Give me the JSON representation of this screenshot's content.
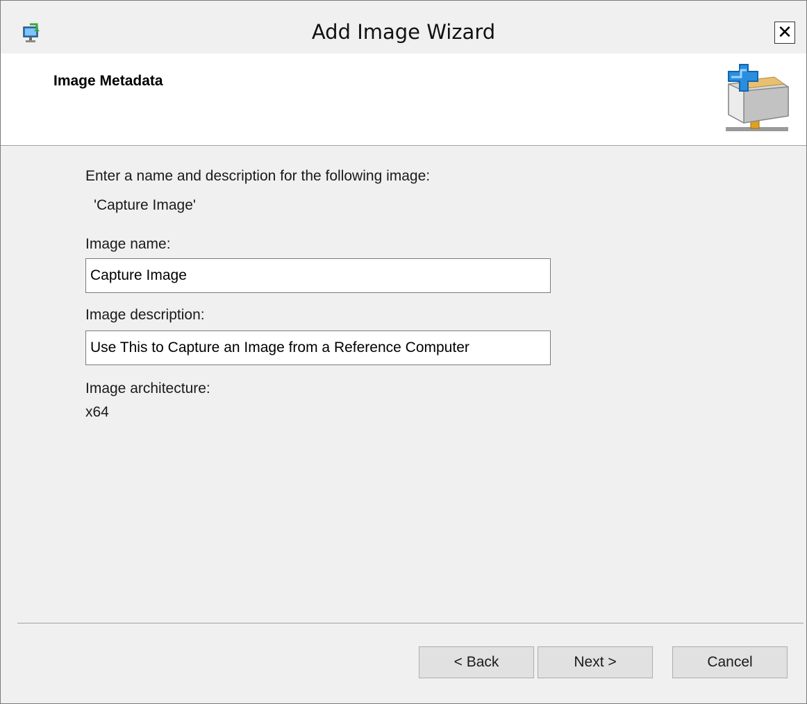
{
  "window": {
    "title": "Add Image Wizard",
    "close_symbol": "✕",
    "app_icon": "wds-computer-icon"
  },
  "header": {
    "title": "Image Metadata",
    "icon": "add-image-store-icon"
  },
  "main": {
    "intro": "Enter a name and description for the following image:",
    "source_image": "'Capture Image'",
    "image_name_label": "Image name:",
    "image_name_value": "Capture Image",
    "image_description_label": "Image description:",
    "image_description_value": "Use This to Capture an Image from a Reference Computer",
    "architecture_label": "Image architecture:",
    "architecture_value": "x64"
  },
  "buttons": {
    "back": "< Back",
    "next": "Next >",
    "cancel": "Cancel"
  },
  "colors": {
    "window_bg": "#f0f0f0",
    "header_bg": "#ffffff",
    "button_bg": "#e1e1e1",
    "accent_blue": "#1e88d8"
  }
}
